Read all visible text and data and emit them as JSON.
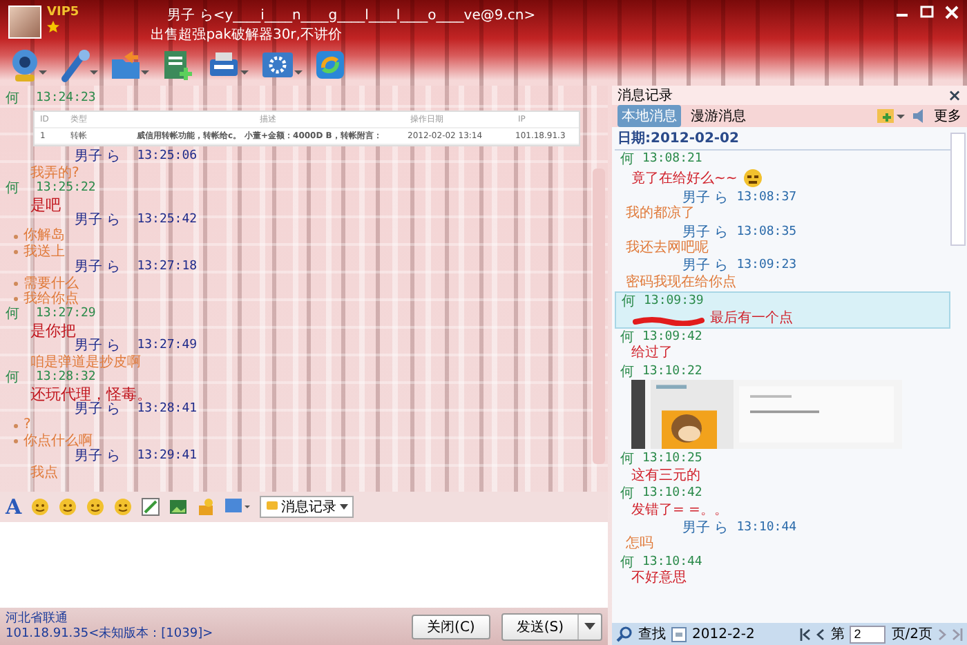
{
  "header": {
    "vip": "VIP5",
    "contact": "男子 ら<y____i____n____g____l____l____o____ve@9.cn>",
    "signature": "出售超强pak破解器30r,不讲价"
  },
  "chat": {
    "messages": [
      {
        "kind": "peer",
        "sender": "何",
        "time": "13:24:23",
        "table": {
          "columns": [
            "ID",
            "类型",
            "描述",
            "操作日期",
            "IP"
          ],
          "row": [
            "1",
            "转帐",
            "威信用转帐功能，转帐给c。",
            "小董+金额：4000D B，转帐附言：",
            "2012-02-02 13:14",
            "101.18.91.3"
          ]
        }
      },
      {
        "kind": "self",
        "sender": "男子 ら",
        "time": "13:25:06",
        "lines": [
          {
            "text": "我弄的?",
            "bullet": false
          }
        ]
      },
      {
        "kind": "peer",
        "sender": "何",
        "time": "13:25:22",
        "lines": [
          {
            "text": "是吧",
            "bullet": false
          }
        ]
      },
      {
        "kind": "self",
        "sender": "男子 ら",
        "time": "13:25:42",
        "lines": [
          {
            "text": "你解岛",
            "bullet": true
          },
          {
            "text": "我送上",
            "bullet": true
          }
        ]
      },
      {
        "kind": "self",
        "sender": "男子 ら",
        "time": "13:27:18",
        "lines": [
          {
            "text": "需要什么",
            "bullet": true
          },
          {
            "text": "我给你点",
            "bullet": true
          }
        ]
      },
      {
        "kind": "peer",
        "sender": "何",
        "time": "13:27:29",
        "lines": [
          {
            "text": "是你把",
            "bullet": false
          }
        ]
      },
      {
        "kind": "self",
        "sender": "男子 ら",
        "time": "13:27:49",
        "lines": [
          {
            "text": "咱是弹道是抄皮啊",
            "bullet": false
          }
        ]
      },
      {
        "kind": "peer",
        "sender": "何",
        "time": "13:28:32",
        "lines": [
          {
            "text": "还玩代理，怪毒。",
            "bullet": false
          }
        ]
      },
      {
        "kind": "self",
        "sender": "男子 ら",
        "time": "13:28:41",
        "lines": [
          {
            "text": "?",
            "bullet": true
          },
          {
            "text": "你点什么啊",
            "bullet": true
          }
        ]
      },
      {
        "kind": "self",
        "sender": "男子 ら",
        "time": "13:29:41",
        "lines": [
          {
            "text": "我点",
            "bullet": false
          }
        ]
      }
    ]
  },
  "format_bar": {
    "font_button": "A",
    "history_button": "消息记录"
  },
  "status": {
    "location": "河北省联通",
    "address": "101.18.91.35<未知版本：[1039]>"
  },
  "buttons": {
    "close": "关闭(C)",
    "send": "发送(S)"
  },
  "history": {
    "title": "消息记录",
    "close": "×",
    "tabs": [
      {
        "label": "本地消息",
        "selected": true
      },
      {
        "label": "漫游消息",
        "selected": false
      }
    ],
    "more": "更多",
    "date": "日期:2012-02-02",
    "entries": [
      {
        "kind": "peer",
        "sender": "何",
        "time": "13:08:21",
        "selected": false,
        "content": [
          {
            "kind": "text",
            "text": "竟了在给好么~~"
          },
          {
            "kind": "emoticon"
          }
        ]
      },
      {
        "kind": "self",
        "sender": "男子 ら",
        "time": "13:08:37",
        "selected": false,
        "content": [
          {
            "kind": "text",
            "text": "我的都凉了"
          }
        ]
      },
      {
        "kind": "self",
        "sender": "男子 ら",
        "time": "13:08:35",
        "selected": false,
        "content": [
          {
            "kind": "text",
            "text": "我还去网吧呢"
          }
        ]
      },
      {
        "kind": "self",
        "sender": "男子 ら",
        "time": "13:09:23",
        "selected": false,
        "content": [
          {
            "kind": "text",
            "text": "密码我现在给你点"
          }
        ]
      },
      {
        "kind": "peer",
        "sender": "何",
        "time": "13:09:39",
        "selected": true,
        "content": [
          {
            "kind": "redacted"
          },
          {
            "kind": "text",
            "text": "最后有一个点"
          }
        ]
      },
      {
        "kind": "peer",
        "sender": "何",
        "time": "13:09:42",
        "selected": false,
        "content": [
          {
            "kind": "text",
            "text": "给过了"
          }
        ]
      },
      {
        "kind": "peer",
        "sender": "何",
        "time": "13:10:22",
        "selected": false
      },
      {
        "kind": "peer",
        "sender": "何",
        "time": "13:10:25",
        "selected": false,
        "content": [
          {
            "kind": "text",
            "text": "这有三元的"
          }
        ]
      },
      {
        "kind": "peer",
        "sender": "何",
        "time": "13:10:42",
        "selected": false,
        "content": [
          {
            "kind": "text",
            "text": "发错了= =。。"
          }
        ]
      },
      {
        "kind": "self",
        "sender": "男子 ら",
        "time": "13:10:44",
        "selected": false,
        "content": [
          {
            "kind": "text",
            "text": "怎吗"
          }
        ]
      },
      {
        "kind": "peer",
        "sender": "何",
        "time": "13:10:44",
        "selected": false,
        "content": [
          {
            "kind": "text",
            "text": "不好意思"
          }
        ]
      }
    ],
    "footer": {
      "search": "查找",
      "date": "2012-2-2",
      "page_prefix": "第",
      "page": "2",
      "page_suffix": "页/2页"
    }
  }
}
